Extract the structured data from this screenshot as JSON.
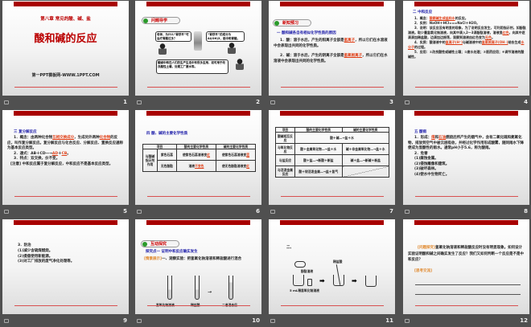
{
  "slides": [
    {
      "number": "1",
      "chapter": "第八章 常见的酸、碱、盐",
      "title": "酸和碱的反应",
      "footer": "第一PPT模板网-WWW.1PPT.COM"
    },
    {
      "number": "2",
      "badge": "问题导学",
      "bubble1": "老师，为什么“胃舒平”可治疗胃酸过多？",
      "bubble2": "“胃舒平”的成分为Al(OH)3，能中和胃酸。",
      "bubble3": "酸碱中和在人们的生产生活中有很多应用，如可用于改良酸性土壤，处理工厂废水等。"
    },
    {
      "number": "3",
      "badge": "新知预习",
      "heading": "一 酸和碱各自有相似化学性质的原因",
      "p1a": "1．酸：溶于水后，产生的阳离子全部是",
      "p1b": "氢离子",
      "p1c": "，所以它们在水溶液中会表现出共同的化学性质。",
      "p2a": "2．碱：溶于水后，产生的阴离子全部是",
      "p2b": "氢氧根离子",
      "p2c": "，所以它们在水溶液中会表现出共同的化学性质。"
    },
    {
      "number": "4",
      "heading": "二 中和反应",
      "p1a": "1．概念：",
      "p1b": "酸跟碱生成盐和水",
      "p1c": "的反应。",
      "p2": "2．实例：NaOH＋HCl===NaCl＋H2O。",
      "p3a": "3．说明：该反应没有明显的现象，为了说明反应发生，可利用指示剂，如酚酞溶液。取少量氢氧化钠溶液，向其中滴入2～3滴酚酞溶液，溶液显",
      "p3b": "红色",
      "p3c": "，向其中逐滴滴加稀盐酸，边滴加边振荡，观察到溶液由红色变为",
      "p3d": "无色",
      "p3e": "。",
      "p4a": "4．实质：酸溶液中的",
      "p4b": "氢离子(H⁺)",
      "p4c": "与碱溶液中的",
      "p4d": "氢氧根离子(OH⁻)",
      "p4e": "结合生成",
      "p4f": "水分子",
      "p4g": "的过程。",
      "p5": "5．应用：①改良酸性或碱性土壤；②废水处理；③医药应用；④调节溶液的酸碱性。"
    },
    {
      "number": "5",
      "heading": "三 复分解反应",
      "p1a": "1．概念：由两种化合物",
      "p1b": "互相交换成分",
      "p1c": "，生成另外两种",
      "p1d": "化合物",
      "p1e": "的反应，叫作复分解反应。复分解反应与化合反应、分解反应、置换反应通称为基本反应类型。",
      "p2a": "2．通式：AB＋CD―→",
      "p2b": "AD",
      "p2c": "＋",
      "p2d": "CB",
      "p2e": "。",
      "p3": "3．特点：双交换，价不变。",
      "p4": "[注意] 中和反应属于复分解反应，中和反应不是基本反应类型。"
    },
    {
      "number": "6",
      "heading": "四 酸、碱的主要化学性质",
      "th": [
        "项目",
        "酸的主要化学性质",
        "碱的主要化学性质"
      ],
      "row_label": "与酸碱指示剂作用",
      "sub1": "紫色石蕊",
      "sub2": "无色酚酞",
      "c1a": "使紫色石蕊溶液变",
      "c1b": "红",
      "c2a": "使紫色石蕊溶液变",
      "c2b": "蓝",
      "c3a": "溶液",
      "c3b": "不变色",
      "c4a": "使无色酚酞溶液变",
      "c4b": "红"
    },
    {
      "number": "7",
      "th": [
        "项目",
        "酸的主要化学性质",
        "碱的主要化学性质"
      ],
      "rows": [
        {
          "label": "酸碱相互反应",
          "acid": "酸＋碱―→盐＋水",
          "base": ""
        },
        {
          "label": "与氧化物反应",
          "acid": "酸＋金属氧化物―→盐＋水",
          "base": "碱＋非金属氧化物―→盐＋水"
        },
        {
          "label": "与盐反应",
          "acid": "酸＋盐―→新酸＋新盐",
          "base": "碱＋盐―→新碱＋新盐"
        },
        {
          "label": "与活泼金属反应",
          "acid": "酸＋较活泼金属―→盐＋氢气",
          "base": ""
        }
      ]
    },
    {
      "number": "8",
      "heading": "五 酸雨",
      "p1a": "1．形成：",
      "p1b": "煤",
      "p1c": "和",
      "p1d": "石油",
      "p1e": "燃烧后所产生的烟气中，含有二氧化硫和氮氧化物，排放到空气中被云层吸收，并经过化学作用形成酸雾，随同雨水下降便成为显酸性的雨水。通常pH小于5.6，称为酸雨。",
      "p2": "2．危害",
      "items": [
        "(1)腐蚀金属。",
        "(2)侵蚀雕像和建筑。",
        "(3)破坏森林。",
        "(4)使水中生物死亡。"
      ]
    },
    {
      "number": "9",
      "heading": "3．防治",
      "items": [
        "(1)减少含硫煤燃烧。",
        "(2)提倡使用新能源。",
        "(3)对工厂排放的废气净化处理等。"
      ]
    },
    {
      "number": "10",
      "badge": "互动探究",
      "heading": "探究点一 证明中和反应确实发生",
      "tag": "[情景展示]",
      "p1": "一、观察实验：把氢氧化钠溶液和稀盐酸进行混合",
      "labels": [
        "氢氧化钠溶液",
        "稀盐酸",
        "二者混合后"
      ]
    },
    {
      "number": "11",
      "heading": "二、",
      "labels": [
        "酚酞溶液",
        "稀盐酸",
        "5 mL稀氢氧化钠溶液"
      ]
    },
    {
      "number": "12",
      "tag1": "[问题探究]",
      "p1": "氢氧化钠溶液和稀盐酸反应时没有明显现象。如何设计实验证明酸和碱之间确实发生了反应？我们又如何判断一个反应是不是中和反应？",
      "tag2": "[思考交流]"
    }
  ],
  "colors": {
    "background": "#505050",
    "title_bar": "#a80000",
    "accent_red": "#e04018",
    "heading_blue": "#1a1aa8"
  }
}
